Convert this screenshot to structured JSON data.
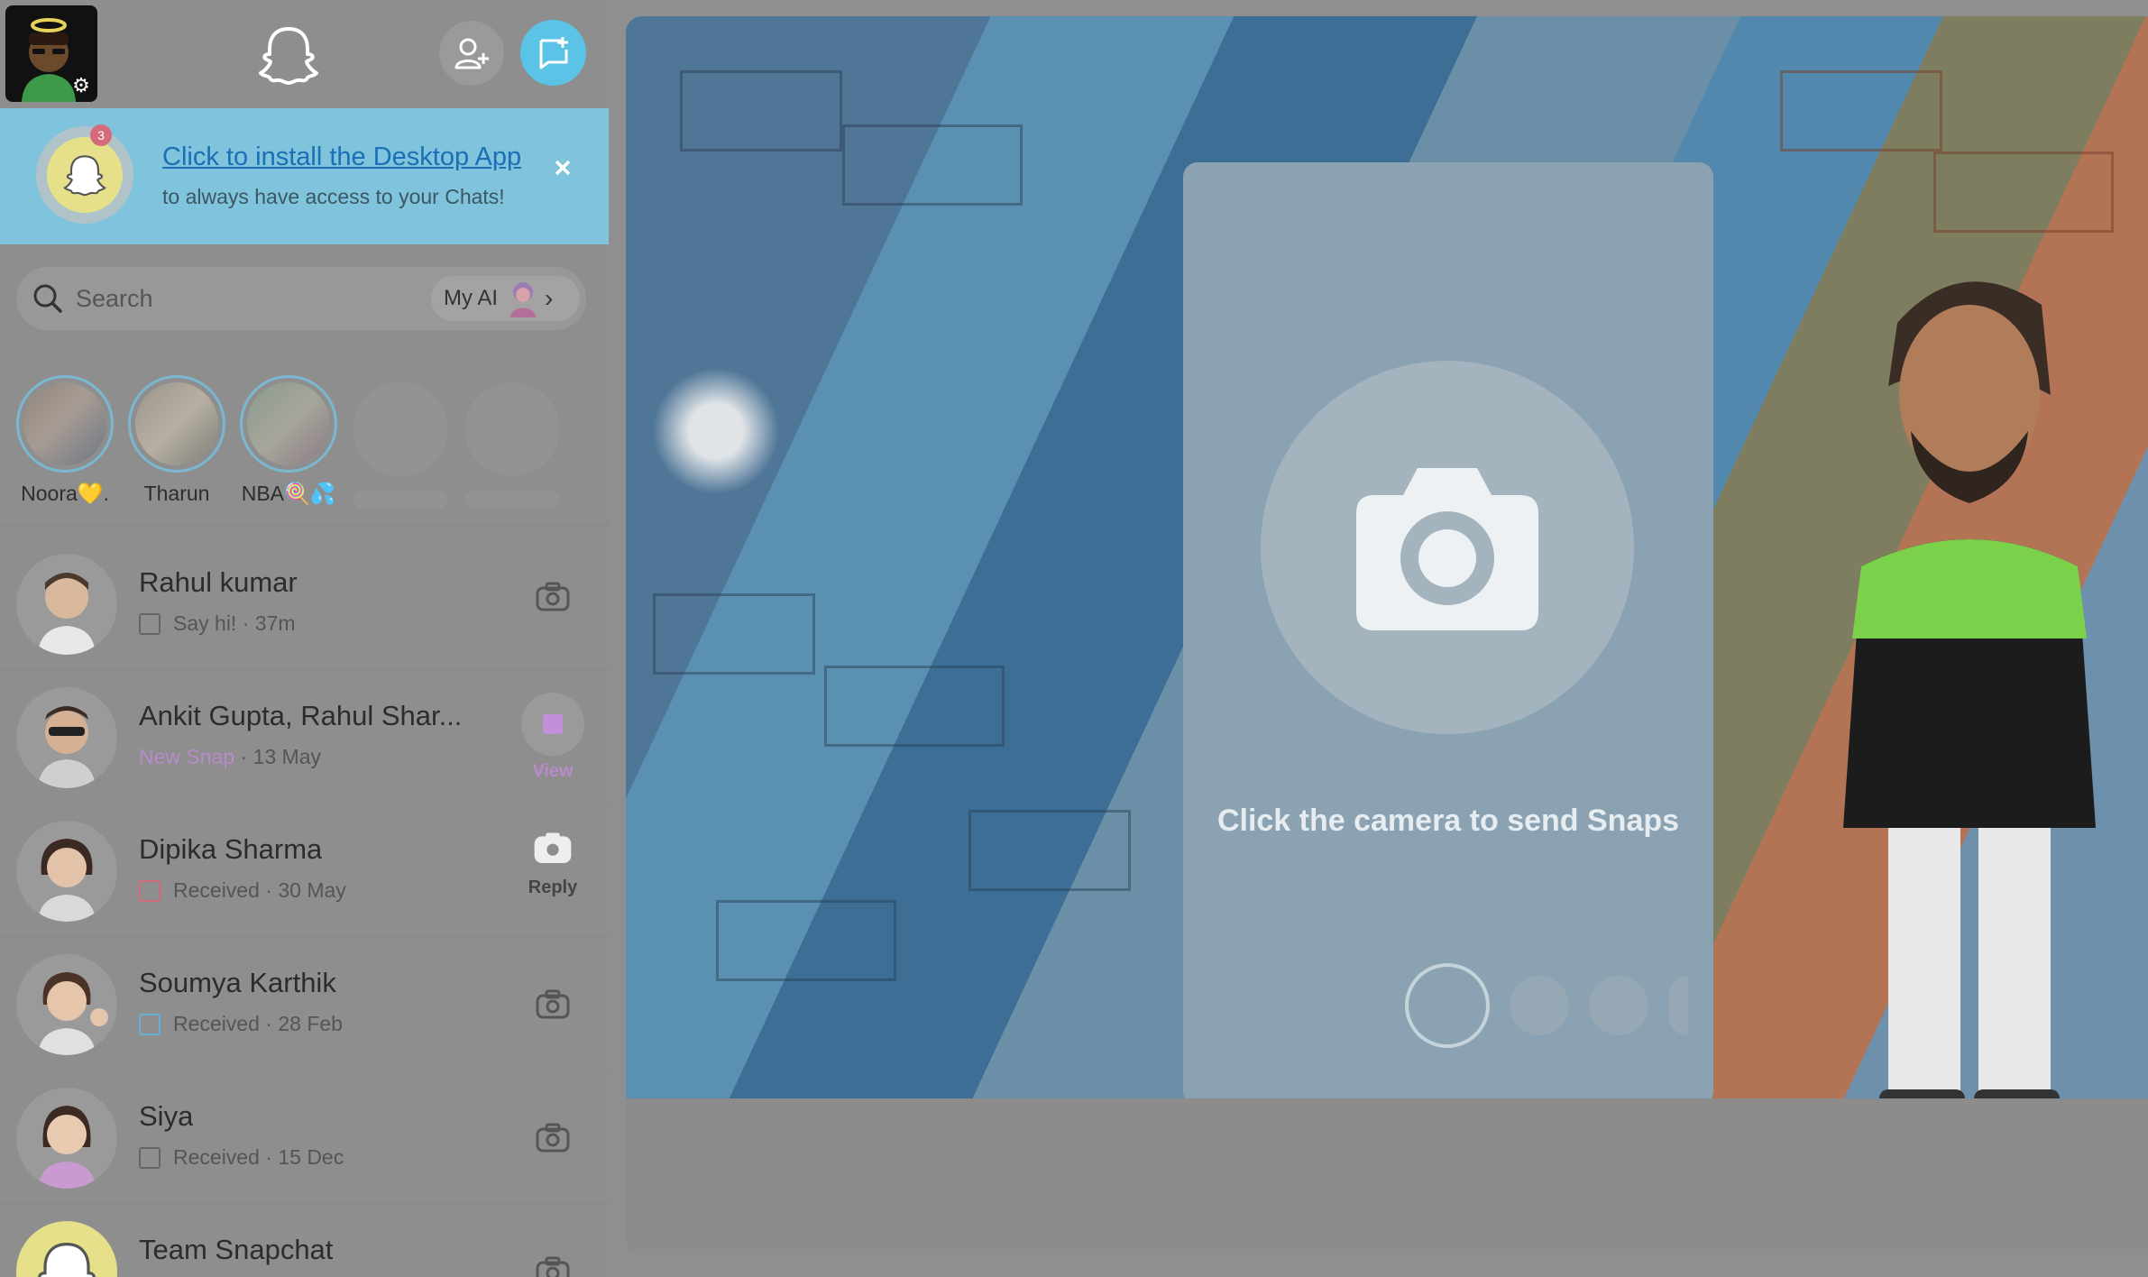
{
  "topbar": {
    "profile_icon": "bitmoji-avatar",
    "logo_icon": "snapchat-ghost-icon",
    "add_friend_icon": "add-friend-icon",
    "new_chat_icon": "new-chat-icon"
  },
  "banner": {
    "title": "Click to install the Desktop App",
    "subtitle": "to always have access to your Chats!",
    "badge_count": "3"
  },
  "search": {
    "placeholder": "Search",
    "my_ai_label": "My AI"
  },
  "stories": [
    {
      "name": "Noora💛."
    },
    {
      "name": "Tharun"
    },
    {
      "name": "NBA🍭💦"
    }
  ],
  "chats": [
    {
      "name": "Rahul kumar",
      "status": "Say hi!",
      "time": "37m",
      "status_color": "#666666",
      "action": ""
    },
    {
      "name": "Ankit Gupta,  Rahul Shar...",
      "status": "New Snap",
      "time": "13 May",
      "status_color": "#b98ac9",
      "action": "View"
    },
    {
      "name": "Dipika Sharma",
      "status": "Received",
      "time": "30 May",
      "status_color": "#d26a7b",
      "action": "Reply"
    },
    {
      "name": "Soumya Karthik",
      "status": "Received",
      "time": "28 Feb",
      "status_color": "#6aaed6",
      "action": ""
    },
    {
      "name": "Siya",
      "status": "Received",
      "time": "15 Dec",
      "status_color": "#666666",
      "action": ""
    },
    {
      "name": "Team Snapchat",
      "status": "",
      "time": "",
      "status_color": "#666666",
      "action": ""
    }
  ],
  "camera": {
    "hint": "Click the camera to send Snaps"
  },
  "colors": {
    "accent": "#5bc3e6",
    "banner_bg": "#7fc4dc",
    "new_snap": "#b98ac9"
  }
}
